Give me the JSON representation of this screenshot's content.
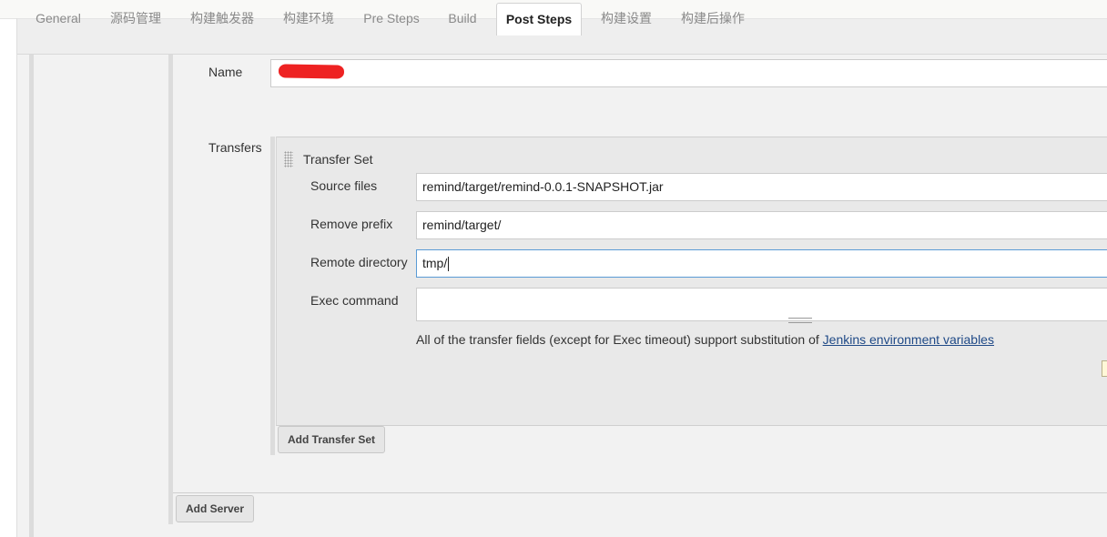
{
  "tabs": [
    {
      "label": "General"
    },
    {
      "label": "源码管理"
    },
    {
      "label": "构建触发器"
    },
    {
      "label": "构建环境"
    },
    {
      "label": "Pre Steps"
    },
    {
      "label": "Build"
    },
    {
      "label": "Post Steps",
      "active": true
    },
    {
      "label": "构建设置"
    },
    {
      "label": "构建后操作"
    }
  ],
  "server": {
    "name_label": "Name",
    "name_value": "",
    "transfers_label": "Transfers"
  },
  "transfer_set": {
    "title": "Transfer Set",
    "source_files_label": "Source files",
    "source_files_value": "remind/target/remind-0.0.1-SNAPSHOT.jar",
    "remove_prefix_label": "Remove prefix",
    "remove_prefix_value": "remind/target/",
    "remote_directory_label": "Remote directory",
    "remote_directory_value": "tmp/",
    "exec_command_label": "Exec command",
    "exec_command_value": "",
    "help_text": "All of the transfer fields (except for Exec timeout) support substitution of ",
    "help_link": "Jenkins environment variables"
  },
  "buttons": {
    "add_transfer_set": "Add Transfer Set",
    "add_server": "Add Server"
  },
  "colors": {
    "active_tab_bg": "#ffffff",
    "link": "#204a87",
    "focus_border": "#5b9bd5",
    "redaction": "#ee2222"
  }
}
